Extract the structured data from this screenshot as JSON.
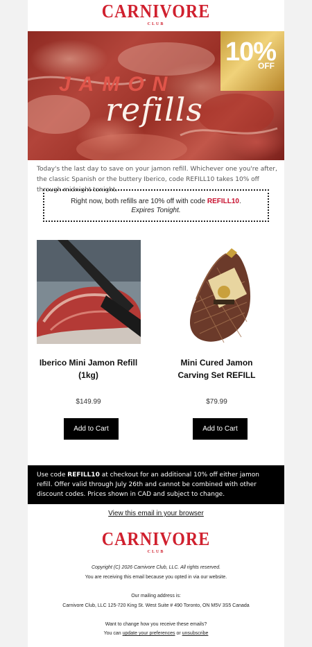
{
  "brand": {
    "name": "CARNIVORE",
    "tagline": "CLUB",
    "color": "#d0202e"
  },
  "hero": {
    "title_line1": "JAMON",
    "title_line2": "refills",
    "badge_percent": "10%",
    "badge_off": "OFF"
  },
  "intro_text": "Today's the last day to save on your jamon refill. Whichever one you're after, the classic Spanish or the buttery Iberico, code REFILL10 takes 10% off through midnight tonight.",
  "promo": {
    "line1_prefix": "Right now, both refills are 10% off with code",
    "code": "REFILL10",
    "line1_suffix": ".",
    "line2": "Expires Tonight."
  },
  "products": [
    {
      "name": "Iberico Mini Jamon Refill (1kg)",
      "price": "$149.99",
      "button": "Add to Cart",
      "image_icon": "iberico-jamon-photo"
    },
    {
      "name": "Mini Cured Jamon Carving Set REFILL",
      "price": "$79.99",
      "button": "Add to Cart",
      "image_icon": "cured-jamon-leg-photo"
    }
  ],
  "checkout_note": {
    "prefix": "Use code",
    "code": "REFILL10",
    "suffix": "at checkout for an additional 10% off either jamon refill. Offer valid through July 26th and cannot be combined with other discount codes. Prices shown in CAD and subject to change."
  },
  "view_in_browser": "View this email in your browser",
  "footer": {
    "copyright": "Copyright (C) 2026 Carnivore Club, LLC. All rights reserved.",
    "optin": "You are receiving this email because you opted in via our website.",
    "mailing_heading": "Our mailing address is:",
    "address": "Carnivore Club, LLC 125-720 King St. West Suite # 490 Toronto, ON M5V 3S5 Canada",
    "change_question": "Want to change how you receive these emails?",
    "can_prefix": "You can",
    "update_link": "update your preferences",
    "or_text": "or",
    "unsubscribe_link": "unsubscribe"
  }
}
